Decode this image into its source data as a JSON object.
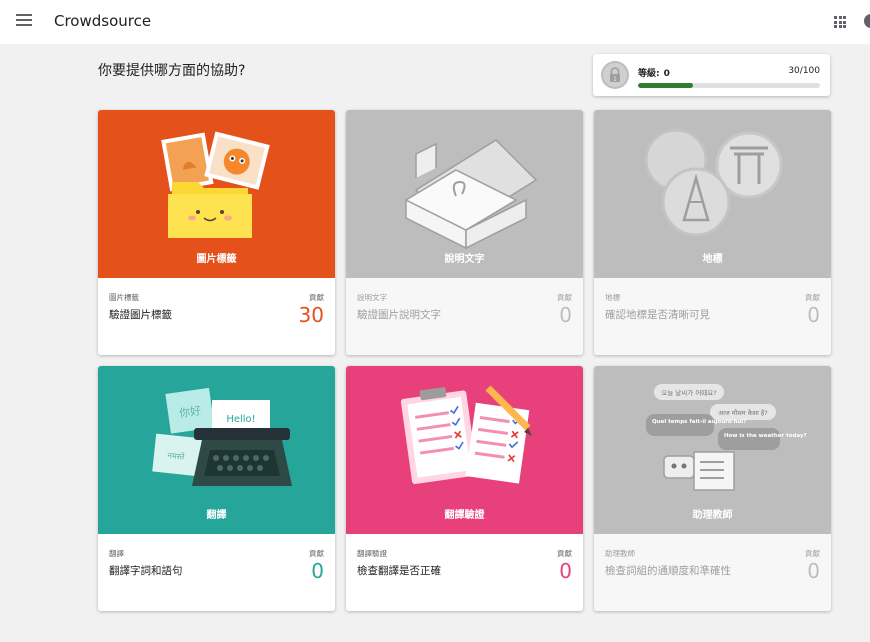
{
  "app": {
    "title": "Crowdsource"
  },
  "heading": "你要提供哪方面的協助?",
  "level": {
    "label": "等級:",
    "value": "0",
    "progress_text": "30/100",
    "progress_fraction": 0.3
  },
  "colors": {
    "image_label": "#e4511b",
    "translation": "#26a69a",
    "translation_validation": "#e8407a",
    "disabled": "#bdbdbd",
    "progress": "#2e7d32",
    "count_image": "#e4511b",
    "count_translation": "#26a69a",
    "count_validation": "#e8407a"
  },
  "contrib_label": "貢獻",
  "cards": [
    {
      "title": "圖片標籤",
      "sub": "圖片標籤",
      "desc": "驗證圖片標籤",
      "count": "30"
    },
    {
      "title": "說明文字",
      "sub": "說明文字",
      "desc": "驗證圖片說明文字",
      "count": "0"
    },
    {
      "title": "地標",
      "sub": "地標",
      "desc": "確認地標是否清晰可見",
      "count": "0"
    },
    {
      "title": "翻譯",
      "sub": "翻譯",
      "desc": "翻譯字詞和語句",
      "count": "0"
    },
    {
      "title": "翻譯驗證",
      "sub": "翻譯驗證",
      "desc": "檢查翻譯是否正確",
      "count": "0"
    },
    {
      "title": "助理教師",
      "sub": "助理教師",
      "desc": "檢查詞組的通順度和準確性",
      "count": "0"
    }
  ],
  "illustration_text": {
    "hello": "Hello!",
    "nihao": "你好",
    "namaste": "नमस्ते",
    "korean": "오늘 날씨가 어때요?",
    "hindi": "आज मौसम कैसा है?",
    "french": "Quel temps fait-il aujourd'hui?",
    "english": "How is the weather today?"
  },
  "icons": [
    "menu-icon",
    "apps-grid-icon",
    "account-icon",
    "lock-icon"
  ]
}
